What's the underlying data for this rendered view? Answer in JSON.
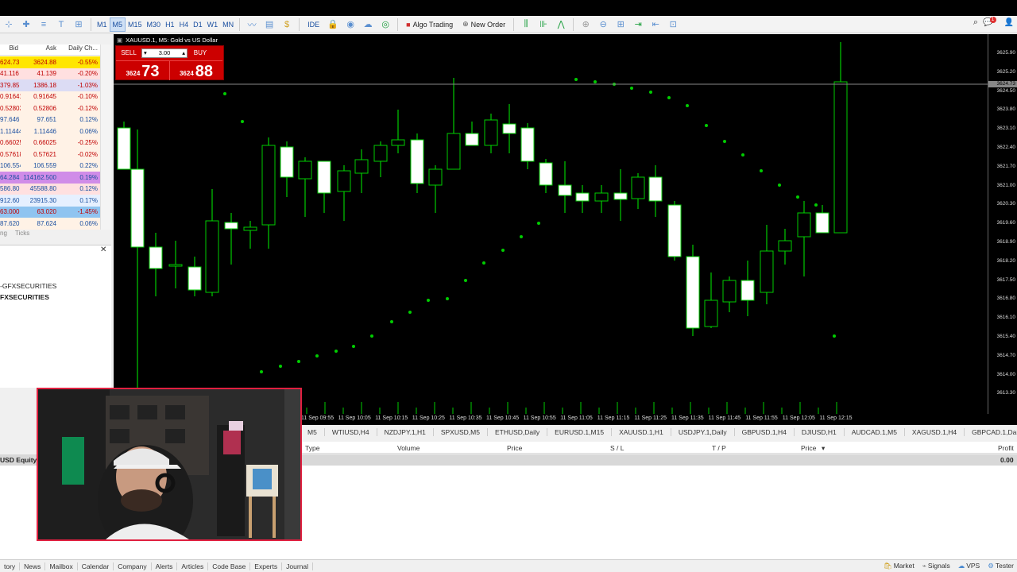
{
  "toolbar": {
    "timeframes": [
      "M1",
      "M5",
      "M15",
      "M30",
      "H1",
      "H4",
      "D1",
      "W1",
      "MN"
    ],
    "active_timeframe": "M5",
    "ide_label": "IDE",
    "algo_trading_label": "Algo Trading",
    "new_order_label": "New Order",
    "notification_count": "1"
  },
  "market_watch": {
    "headers": {
      "bid": "Bid",
      "ask": "Ask",
      "change": "Daily Ch..."
    },
    "rows": [
      {
        "bid": "624.73",
        "ask": "3624.88",
        "change": "-0.55%",
        "bg": "#ffe600",
        "color": "#c00000"
      },
      {
        "bid": "41.116",
        "ask": "41.139",
        "change": "-0.20%",
        "bg": "#ffe0e0",
        "color": "#c00000"
      },
      {
        "bid": "379.85",
        "ask": "1386.18",
        "change": "-1.03%",
        "bg": "#dcdcf4",
        "color": "#c00000"
      },
      {
        "bid": "0.91641",
        "ask": "0.91645",
        "change": "-0.10%",
        "bg": "#fff2e6",
        "color": "#c00000"
      },
      {
        "bid": "0.52803",
        "ask": "0.52806",
        "change": "-0.12%",
        "bg": "#fff2e6",
        "color": "#c00000"
      },
      {
        "bid": "97.646",
        "ask": "97.651",
        "change": "0.12%",
        "bg": "#fff2e6",
        "color": "#1a4fa0"
      },
      {
        "bid": "1.11444",
        "ask": "1.11446",
        "change": "0.06%",
        "bg": "#fff2e6",
        "color": "#1a4fa0"
      },
      {
        "bid": "0.66025",
        "ask": "0.66025",
        "change": "-0.25%",
        "bg": "#fff2e6",
        "color": "#c00000"
      },
      {
        "bid": "0.57618",
        "ask": "0.57621",
        "change": "-0.02%",
        "bg": "#fff2e6",
        "color": "#c00000"
      },
      {
        "bid": "106.554",
        "ask": "106.559",
        "change": "0.22%",
        "bg": "#fff2e6",
        "color": "#1a4fa0"
      },
      {
        "bid": "64.284",
        "ask": "114162.500",
        "change": "0.19%",
        "bg": "#d08ce8",
        "color": "#1a4fa0"
      },
      {
        "bid": "586.80",
        "ask": "45588.80",
        "change": "0.12%",
        "bg": "#ffe0e0",
        "color": "#1a4fa0"
      },
      {
        "bid": "912.60",
        "ask": "23915.30",
        "change": "0.17%",
        "bg": "#e6f0ff",
        "color": "#1a4fa0"
      },
      {
        "bid": "63.000",
        "ask": "63.020",
        "change": "-1.45%",
        "bg": "#8fc4f0",
        "color": "#c00000"
      },
      {
        "bid": "87.620",
        "ask": "87.624",
        "change": "0.06%",
        "bg": "#fff2e6",
        "color": "#1a4fa0"
      }
    ],
    "tab_partial": "ng",
    "tab_ticks": "Ticks"
  },
  "navigator": {
    "item1": "-GFXSECURITIES",
    "item2": "FXSECURITIES"
  },
  "chart": {
    "title": "XAUUSD.1, M5:  Gold vs US Dollar",
    "price_labels": [
      "3625.90",
      "3625.20",
      "3624.50",
      "3623.80",
      "3623.10",
      "3622.40",
      "3621.70",
      "3621.00",
      "3620.30",
      "3619.60",
      "3618.90",
      "3618.20",
      "3617.50",
      "3616.80",
      "3616.10",
      "3615.40",
      "3614.70",
      "3614.00",
      "3613.30"
    ],
    "current_price_tag": "3624.73",
    "time_labels": [
      "11 Sep 09:55",
      "11 Sep 10:05",
      "11 Sep 10:15",
      "11 Sep 10:25",
      "11 Sep 10:35",
      "11 Sep 10:45",
      "11 Sep 10:55",
      "11 Sep 11:05",
      "11 Sep 11:15",
      "11 Sep 11:25",
      "11 Sep 11:35",
      "11 Sep 11:45",
      "11 Sep 11:55",
      "11 Sep 12:05",
      "11 Sep 12:15"
    ],
    "one_click": {
      "sell_label": "SELL",
      "buy_label": "BUY",
      "volume": "3.00",
      "sell_price_small": "3624",
      "sell_price_big": "73",
      "buy_price_small": "3624",
      "buy_price_big": "88"
    },
    "candle_color": "#00cc00",
    "bull_fill": "#000000",
    "bear_fill": "#ffffff"
  },
  "symbol_tabs": [
    "M5",
    "WTIUSD,H4",
    "NZDJPY.1,H1",
    "SPXUSD,M5",
    "ETHUSD,Daily",
    "EURUSD.1,M15",
    "XAUUSD.1,H1",
    "USDJPY.1,Daily",
    "GBPUSD.1,H4",
    "DJIUSD,H1",
    "AUDCAD.1,M5",
    "XAGUSD.1,H4",
    "GBPCAD.1,Daily"
  ],
  "trade_table": {
    "headers": {
      "type": "Type",
      "volume": "Volume",
      "price": "Price",
      "sl": "S / L",
      "tp": "T / P",
      "price2": "Price",
      "profit": "Profit"
    }
  },
  "balance": {
    "label": "USD  Equity",
    "profit": "0.00"
  },
  "bottom_tabs": [
    "tory",
    "News",
    "Mailbox",
    "Calendar",
    "Company",
    "Alerts",
    "Articles",
    "Code Base",
    "Experts",
    "Journal"
  ],
  "status": {
    "market": "Market",
    "signals": "Signals",
    "vps": "VPS",
    "tester": "Tester"
  }
}
